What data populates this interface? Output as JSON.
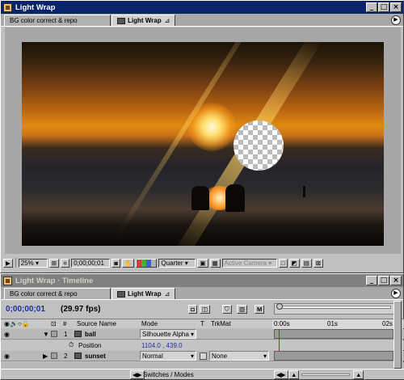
{
  "comp_window": {
    "title": "Light Wrap",
    "tabs": [
      {
        "label": "BG color correct & repo"
      },
      {
        "label": "Light Wrap"
      }
    ],
    "controls": {
      "minimize": "_",
      "maximize": "□",
      "close": "×"
    }
  },
  "viewer_toolbar": {
    "magnification": "25%",
    "timecode": "0;00;00;01",
    "resolution": "Quarter",
    "view": "Active Camera",
    "channel_colors": [
      "#d04040",
      "#40b040",
      "#4060d0",
      "#b0b0b0"
    ]
  },
  "timeline_window": {
    "title": "Light Wrap · Timeline",
    "tabs": [
      {
        "label": "BG color correct & repo"
      },
      {
        "label": "Light Wrap"
      }
    ],
    "current_time": "0;00;00;01",
    "fps": "(29.97 fps)",
    "columns": {
      "number": "#",
      "source_name": "Source Name",
      "mode": "Mode",
      "t": "T",
      "trkmat": "TrkMat"
    },
    "ruler_ticks": [
      "0:00s",
      "01s",
      "02s"
    ],
    "layers": [
      {
        "num": "1",
        "name": "ball",
        "mode": "Silhouette Alpha",
        "trkmat": ""
      },
      {
        "num": "2",
        "name": "sunset",
        "mode": "Normal",
        "trkmat": "None"
      }
    ],
    "property": {
      "name": "Position",
      "value": "1104.0 , 439.0"
    },
    "switches_label": "Switches / Modes"
  }
}
